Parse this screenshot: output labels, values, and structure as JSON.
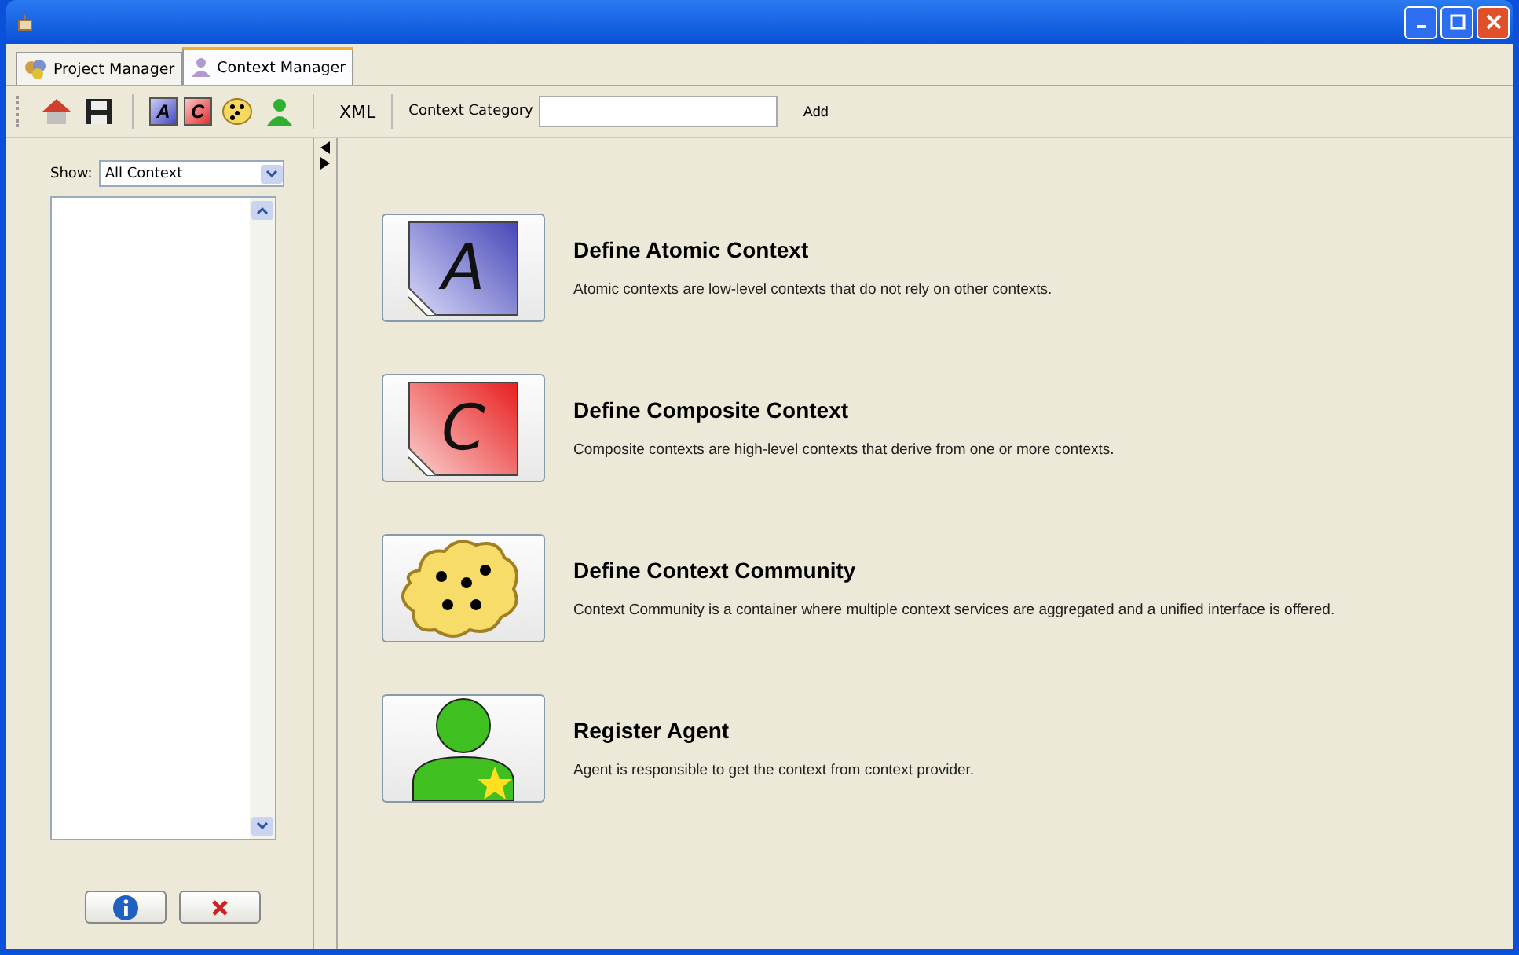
{
  "tabs": [
    {
      "label": "Project Manager",
      "kind": "project",
      "selected": false
    },
    {
      "label": "Context Manager",
      "kind": "context",
      "selected": true
    }
  ],
  "toolbar": {
    "icons": [
      {
        "kind": "home"
      },
      {
        "kind": "save"
      },
      {
        "kind": "atomic",
        "glyph": "A"
      },
      {
        "kind": "composite",
        "glyph": "C"
      },
      {
        "kind": "community"
      },
      {
        "kind": "agent"
      }
    ],
    "xml": "XML",
    "category_label": "Context Category",
    "add": "Add"
  },
  "sidebar": {
    "show_label": "Show:",
    "show_value": "All Context"
  },
  "actions": [
    {
      "kind": "atomic",
      "glyph": "A",
      "title": "Define Atomic Context",
      "description": "Atomic contexts are low-level contexts that do not rely on other contexts."
    },
    {
      "kind": "composite",
      "glyph": "C",
      "title": "Define Composite Context",
      "description": "Composite contexts are high-level contexts that derive from one or more contexts."
    },
    {
      "kind": "community",
      "title": "Define Context Community",
      "description": "Context Community is a container where multiple context services are aggregated and a unified interface is offered."
    },
    {
      "kind": "agent",
      "title": "Register Agent",
      "description": "Agent is responsible to get the context from context provider."
    }
  ]
}
